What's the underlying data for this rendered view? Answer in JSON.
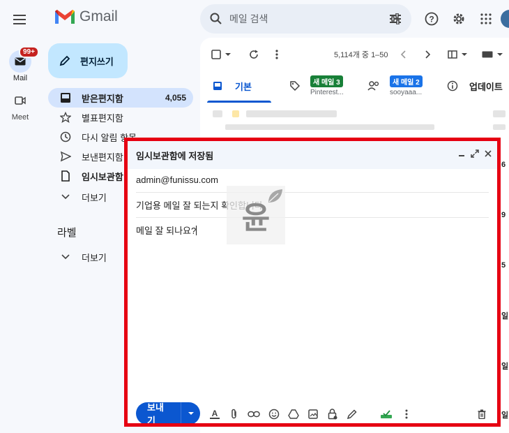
{
  "header": {
    "app_name": "Gmail",
    "search_placeholder": "메일 검색"
  },
  "rail": {
    "mail_label": "Mail",
    "mail_badge": "99+",
    "meet_label": "Meet"
  },
  "compose_button": "편지쓰기",
  "nav": {
    "inbox": "받은편지함",
    "inbox_count": "4,055",
    "starred": "별표편지함",
    "snoozed": "다시 알림 항목",
    "sent": "보낸편지함",
    "drafts": "임시보관함",
    "more": "더보기"
  },
  "labels_section": {
    "title": "라벨",
    "more": "더보기"
  },
  "toolbar": {
    "page_count": "5,114개 중 1–50"
  },
  "tabs": [
    {
      "label": "기본"
    },
    {
      "badge": "새 메일 3",
      "badge_color": "#188038",
      "sub": "Pinterest..."
    },
    {
      "badge": "새 메일 2",
      "badge_color": "#1a73e8",
      "sub": "sooyaaa..."
    },
    {
      "label": "업데이트"
    }
  ],
  "side_digits": [
    "6",
    "9",
    "5",
    "일",
    "일",
    "일"
  ],
  "compose_window": {
    "title": "임시보관함에 저장됨",
    "to": "admin@funissu.com",
    "subject": "기업용 메일 잘 되는지 확인합니다.",
    "body": "메일 잘 되나요?",
    "send_label": "보내기"
  },
  "watermark_text": "윤",
  "colors": {
    "accent": "#0b57d0",
    "highlight_frame": "#e60012",
    "compose_bg": "#c2e7ff",
    "nav_active": "#d3e3fd"
  }
}
